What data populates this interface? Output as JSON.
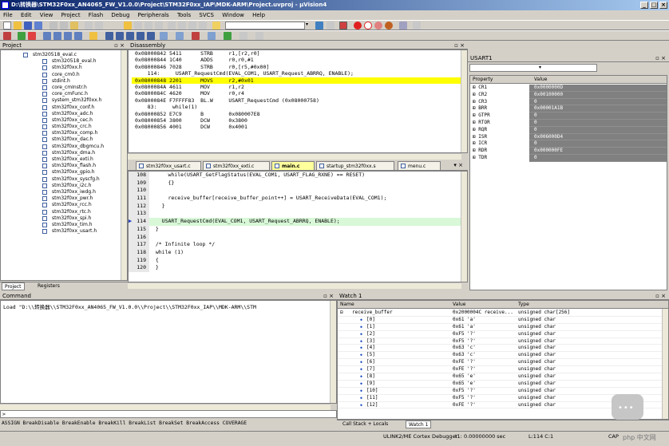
{
  "window": {
    "title": "D:\\转换器\\STM32F0xx_AN4065_FW_V1.0.0\\Project\\STM32F0xx_IAP\\MDK-ARM\\Project.uvproj - µVision4"
  },
  "menu": [
    "File",
    "Edit",
    "View",
    "Project",
    "Flash",
    "Debug",
    "Peripherals",
    "Tools",
    "SVCS",
    "Window",
    "Help"
  ],
  "project": {
    "title": "Project",
    "root": "stm320518_eval.c",
    "files": [
      "stm320518_eval.h",
      "stm32f0xx.h",
      "core_cm0.h",
      "stdint.h",
      "core_cmInstr.h",
      "core_cmFunc.h",
      "system_stm32f0xx.h",
      "stm32f0xx_conf.h",
      "stm32f0xx_adc.h",
      "stm32f0xx_cec.h",
      "stm32f0xx_crc.h",
      "stm32f0xx_comp.h",
      "stm32f0xx_dac.h",
      "stm32f0xx_dbgmcu.h",
      "stm32f0xx_dma.h",
      "stm32f0xx_exti.h",
      "stm32f0xx_flash.h",
      "stm32f0xx_gpio.h",
      "stm32f0xx_syscfg.h",
      "stm32f0xx_i2c.h",
      "stm32f0xx_iwdg.h",
      "stm32f0xx_pwr.h",
      "stm32f0xx_rcc.h",
      "stm32f0xx_rtc.h",
      "stm32f0xx_spi.h",
      "stm32f0xx_tim.h",
      "stm32f0xx_usart.h"
    ],
    "tabs": [
      "Project",
      "Registers"
    ]
  },
  "disassembly": {
    "title": "Disassembly",
    "lines": [
      "0x08000842 5411      STRB     r1,[r2,r0]",
      "0x08000844 1C40      ADDS     r0,r0,#1",
      "0x08000846 7028      STRB     r0,[r5,#0x00]",
      "    114:     USART_RequestCmd(EVAL_COM1, USART_Request_ABRRQ, ENABLE);",
      "0x08000848 2201      MOVS     r2,#0x01",
      "0x0800084A 4611      MOV      r1,r2",
      "0x0800084C 4620      MOV      r0,r4",
      "0x0800084E F7FFFF83  BL.W     USART_RequestCmd (0x08000758)",
      "    83:     while(1)",
      "0x08000852 E7C9      B        0x080007E8",
      "0x08000854 3800      DCW      0x3800",
      "0x08000856 4001      DCW      0x4001"
    ]
  },
  "editor": {
    "tabs": [
      "stm32f0xx_usart.c",
      "stm32f0xx_exti.c",
      "main.c",
      "startup_stm32f0xx.s",
      "menu.c"
    ],
    "lines": [
      {
        "n": "108",
        "t": "      while(USART_GetFlagStatus(EVAL_COM1, USART_FLAG_RXNE) == RESET)"
      },
      {
        "n": "109",
        "t": "      {}"
      },
      {
        "n": "110",
        "t": ""
      },
      {
        "n": "111",
        "t": "      receive_buffer[receive_buffer_point++] = USART_ReceiveData(EVAL_COM1);"
      },
      {
        "n": "112",
        "t": "    }"
      },
      {
        "n": "113",
        "t": ""
      },
      {
        "n": "114",
        "t": "    USART_RequestCmd(EVAL_COM1, USART_Request_ABRRQ, ENABLE);"
      },
      {
        "n": "115",
        "t": "  }"
      },
      {
        "n": "116",
        "t": ""
      },
      {
        "n": "117",
        "t": "  /* Infinite loop */"
      },
      {
        "n": "118",
        "t": "  while (1)"
      },
      {
        "n": "119",
        "t": "  {"
      },
      {
        "n": "120",
        "t": "  }"
      }
    ]
  },
  "usart": {
    "title": "USART1",
    "headers": [
      "Property",
      "Value"
    ],
    "rows": [
      {
        "p": "CR1",
        "v": "0x0000000D"
      },
      {
        "p": "CR2",
        "v": "0x00100000"
      },
      {
        "p": "CR3",
        "v": "0"
      },
      {
        "p": "BRR",
        "v": "0x00001A1B"
      },
      {
        "p": "GTPR",
        "v": "0"
      },
      {
        "p": "RTOR",
        "v": "0"
      },
      {
        "p": "RQR",
        "v": "0"
      },
      {
        "p": "ISR",
        "v": "0x006000D4"
      },
      {
        "p": "ICR",
        "v": "0"
      },
      {
        "p": "RDR",
        "v": "0x000000FE"
      },
      {
        "p": "TDR",
        "v": "0"
      }
    ]
  },
  "command": {
    "title": "Command",
    "load": "Load \"D:\\\\转换器\\\\STM32F0xx_AN4065_FW_V1.0.0\\\\Project\\\\STM32F0xx_IAP\\\\MDK-ARM\\\\STM",
    "prompt": ">",
    "hint": "ASSIGN BreakDisable BreakEnable BreakKill BreakList BreakSet BreakAccess COVERAGE"
  },
  "watch": {
    "title": "Watch 1",
    "headers": [
      "Name",
      "Value",
      "Type"
    ],
    "root": {
      "name": "receive_buffer",
      "value": "0x2000004C receive...",
      "type": "unsigned char[256]"
    },
    "items": [
      {
        "name": "[0]",
        "value": "0x61 'a'",
        "type": "unsigned char"
      },
      {
        "name": "[1]",
        "value": "0x61 'a'",
        "type": "unsigned char"
      },
      {
        "name": "[2]",
        "value": "0xF5 '?'",
        "type": "unsigned char"
      },
      {
        "name": "[3]",
        "value": "0xF5 '?'",
        "type": "unsigned char"
      },
      {
        "name": "[4]",
        "value": "0x63 'c'",
        "type": "unsigned char"
      },
      {
        "name": "[5]",
        "value": "0x63 'c'",
        "type": "unsigned char"
      },
      {
        "name": "[6]",
        "value": "0xFE '?'",
        "type": "unsigned char"
      },
      {
        "name": "[7]",
        "value": "0xFE '?'",
        "type": "unsigned char"
      },
      {
        "name": "[8]",
        "value": "0x65 'e'",
        "type": "unsigned char"
      },
      {
        "name": "[9]",
        "value": "0x65 'e'",
        "type": "unsigned char"
      },
      {
        "name": "[10]",
        "value": "0xF5 '?'",
        "type": "unsigned char"
      },
      {
        "name": "[11]",
        "value": "0xF5 '?'",
        "type": "unsigned char"
      },
      {
        "name": "[12]",
        "value": "0xFE '?'",
        "type": "unsigned char"
      }
    ],
    "tabs": [
      "Call Stack + Locals",
      "Watch 1"
    ]
  },
  "status": {
    "debugger": "ULINK2/ME Cortex Debugger",
    "time": "t1: 0.00000000 sec",
    "pos": "L:114 C:1",
    "caps": "CAP",
    "watermark": "php 中文网"
  }
}
